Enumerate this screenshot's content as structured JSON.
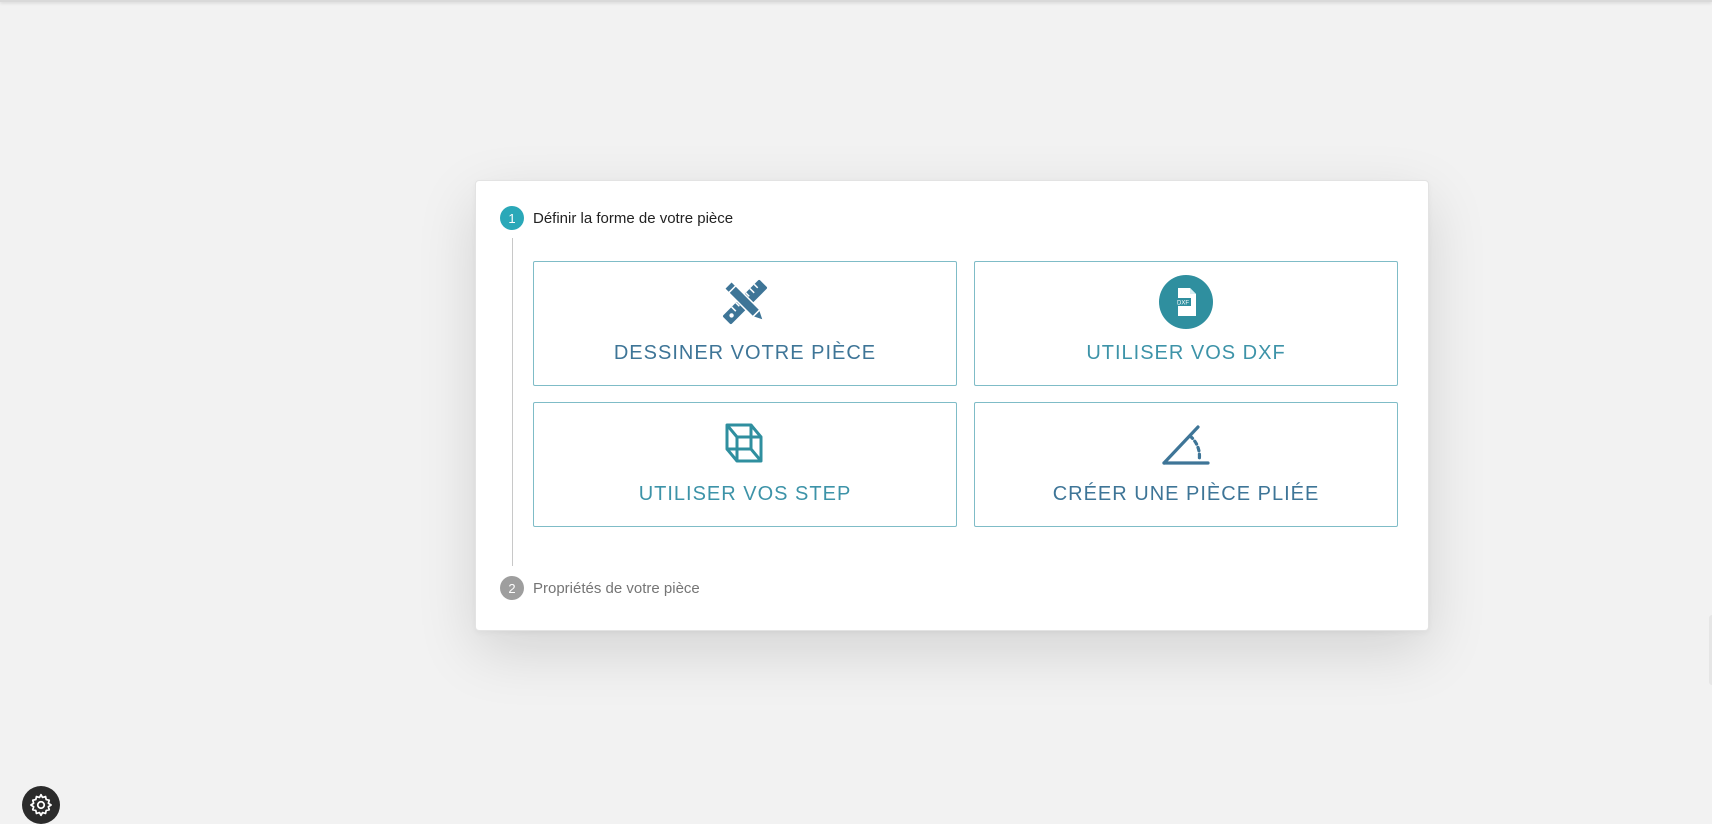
{
  "steps": [
    {
      "number": "1",
      "label": "Définir la forme de votre pièce",
      "state": "active"
    },
    {
      "number": "2",
      "label": "Propriétés de votre pièce",
      "state": "inactive"
    }
  ],
  "options": [
    {
      "label": "DESSINER VOTRE PIÈCE",
      "icon": "pencil-ruler-icon"
    },
    {
      "label": "UTILISER VOS DXF",
      "icon": "dxf-file-icon",
      "icon_text": "DXF"
    },
    {
      "label": "UTILISER VOS STEP",
      "icon": "3d-cube-icon"
    },
    {
      "label": "CRÉER UNE PIÈCE PLIÉE",
      "icon": "bend-angle-icon"
    }
  ],
  "settings": {
    "icon": "gear-icon"
  },
  "colors": {
    "accent": "#2aa8b8",
    "icon_blue": "#3e7597",
    "icon_teal": "#2f8f9f",
    "border": "#7fbcc7",
    "inactive_step": "#9e9e9e"
  }
}
